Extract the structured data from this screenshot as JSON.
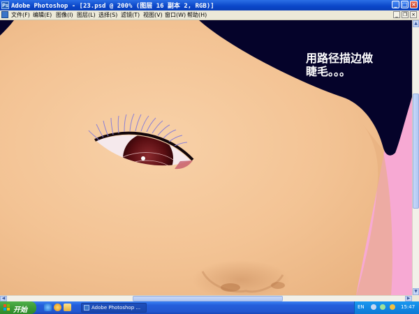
{
  "window": {
    "title": "Adobe Photoshop - [23.psd @ 200% (图层 16 副本 2, RGB)]",
    "app_icon": "photoshop-icon",
    "app_icon_text": "Ps",
    "controls": {
      "minimize": "_",
      "maximize": "□",
      "close": "×"
    }
  },
  "menubar": {
    "items": [
      {
        "label": "文件(F)"
      },
      {
        "label": "编辑(E)"
      },
      {
        "label": "图像(I)"
      },
      {
        "label": "图层(L)"
      },
      {
        "label": "选择(S)"
      },
      {
        "label": "滤镜(T)"
      },
      {
        "label": "视图(V)"
      },
      {
        "label": "窗口(W)"
      },
      {
        "label": "帮助(H)"
      }
    ],
    "doc_controls": {
      "minimize": "_",
      "restore": "❐",
      "close": "×"
    }
  },
  "canvas": {
    "caption_line1": "用路径描边做",
    "caption_line2": "睫毛。。。",
    "colors": {
      "skin": "#f3c79b",
      "hair": "#05032a",
      "background_pink": "#f7a9d3",
      "iris": "#5a0e12",
      "lash": "#8b7fd6"
    }
  },
  "scrollbars": {
    "up": "▲",
    "down": "▼",
    "left": "◀",
    "right": "▶"
  },
  "taskbar": {
    "start_label": "开始",
    "quick_launch": [
      "ie-icon",
      "media-icon",
      "folder-icon"
    ],
    "task_label": "Adobe Photoshop ...",
    "tray": {
      "language": "EN",
      "icons": [
        "volume-icon",
        "network-icon",
        "security-icon"
      ],
      "clock": "15:47"
    }
  }
}
